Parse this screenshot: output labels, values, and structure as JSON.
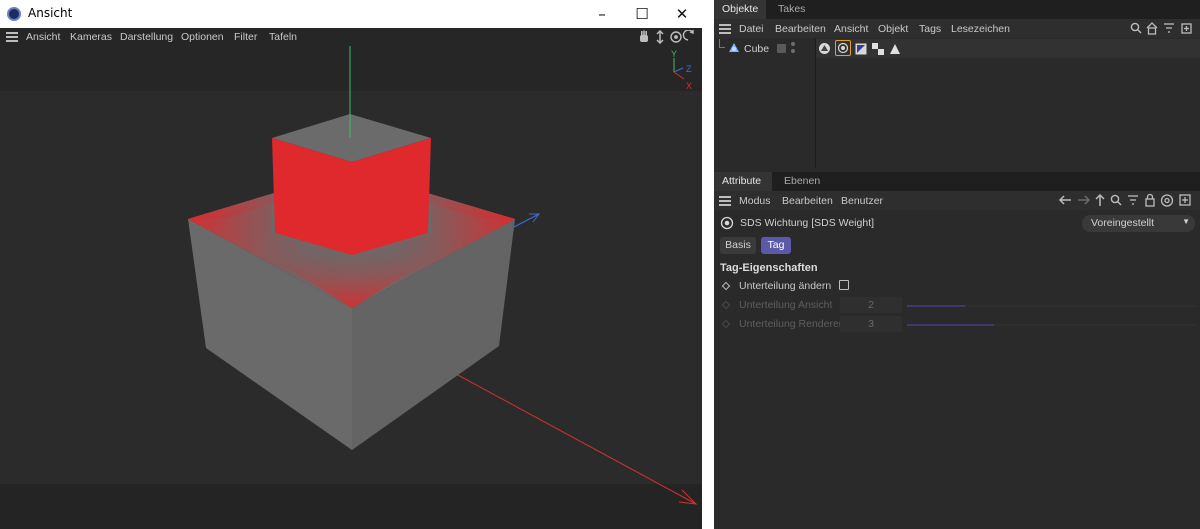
{
  "viewport_window": {
    "title": "Ansicht",
    "menu": [
      "Ansicht",
      "Kameras",
      "Darstellung",
      "Optionen",
      "Filter",
      "Tafeln"
    ],
    "axis_labels": {
      "y": "Y",
      "z": "Z",
      "x": "X"
    },
    "colors": {
      "selection": "#e0292c",
      "mesh": "#6a6a6a",
      "background": "#2b2b2b"
    }
  },
  "objects_panel": {
    "tabs": [
      "Objekte",
      "Takes"
    ],
    "menu": [
      "Datei",
      "Bearbeiten",
      "Ansicht",
      "Objekt",
      "Tags",
      "Lesezeichen"
    ],
    "object": {
      "name": "Cube",
      "icon": "cube-icon"
    },
    "tag_icons": [
      "phong-tag-icon",
      "sds-weight-tag-icon",
      "selection-tag-icon",
      "texture-tag-icon",
      "polygon-selection-tag-icon"
    ]
  },
  "attributes_panel": {
    "tabs": [
      "Attribute",
      "Ebenen"
    ],
    "menu": [
      "Modus",
      "Bearbeiten",
      "Benutzer"
    ],
    "header_title": "SDS Wichtung [SDS Weight]",
    "preset": "Voreingestellt",
    "mode_buttons": [
      "Basis",
      "Tag"
    ],
    "active_mode": "Tag",
    "section_title": "Tag-Eigenschaften",
    "params": [
      {
        "label": "Unterteilung ändern",
        "type": "checkbox",
        "checked": false
      },
      {
        "label": "Unterteilung Ansicht",
        "value": "2",
        "slider": 0.2,
        "disabled": true
      },
      {
        "label": "Unterteilung Renderer",
        "value": "3",
        "slider": 0.3,
        "disabled": true
      }
    ],
    "accent": "#5a5aa8"
  }
}
